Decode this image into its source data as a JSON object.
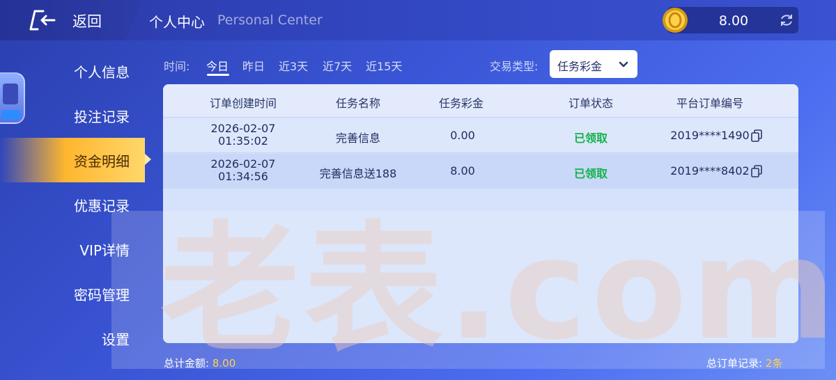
{
  "header": {
    "back_label": "返回",
    "title": "个人中心",
    "title_en": "Personal Center",
    "balance": "8.00"
  },
  "sidebar": {
    "items": [
      {
        "label": "个人信息"
      },
      {
        "label": "投注记录"
      },
      {
        "label": "资金明细",
        "active": true
      },
      {
        "label": "优惠记录"
      },
      {
        "label": "VIP详情"
      },
      {
        "label": "密码管理"
      },
      {
        "label": "设置"
      }
    ]
  },
  "filters": {
    "time_label": "时间:",
    "tabs": [
      "今日",
      "昨日",
      "近3天",
      "近7天",
      "近15天"
    ],
    "active_tab": "今日",
    "type_label": "交易类型:",
    "type_value": "任务彩金"
  },
  "table": {
    "columns": [
      "订单创建时间",
      "任务名称",
      "任务彩金",
      "订单状态",
      "平台订单编号"
    ],
    "rows": [
      {
        "date": "2026-02-07",
        "time": "01:35:02",
        "name": "完善信息",
        "amount": "0.00",
        "status": "已领取",
        "order": "2019****1490"
      },
      {
        "date": "2026-02-07",
        "time": "01:34:56",
        "name": "完善信息送188",
        "amount": "8.00",
        "status": "已领取",
        "order": "2019****8402"
      }
    ]
  },
  "footer": {
    "total_label": "总计金额:",
    "total_value": "8.00",
    "count_label": "总订单记录:",
    "count_value": "2条"
  },
  "watermark": "老表.com",
  "colors": {
    "active_tab_gold": "#ffb62e",
    "status_green": "#13b24a",
    "highlight_yellow": "#ffd34d"
  }
}
